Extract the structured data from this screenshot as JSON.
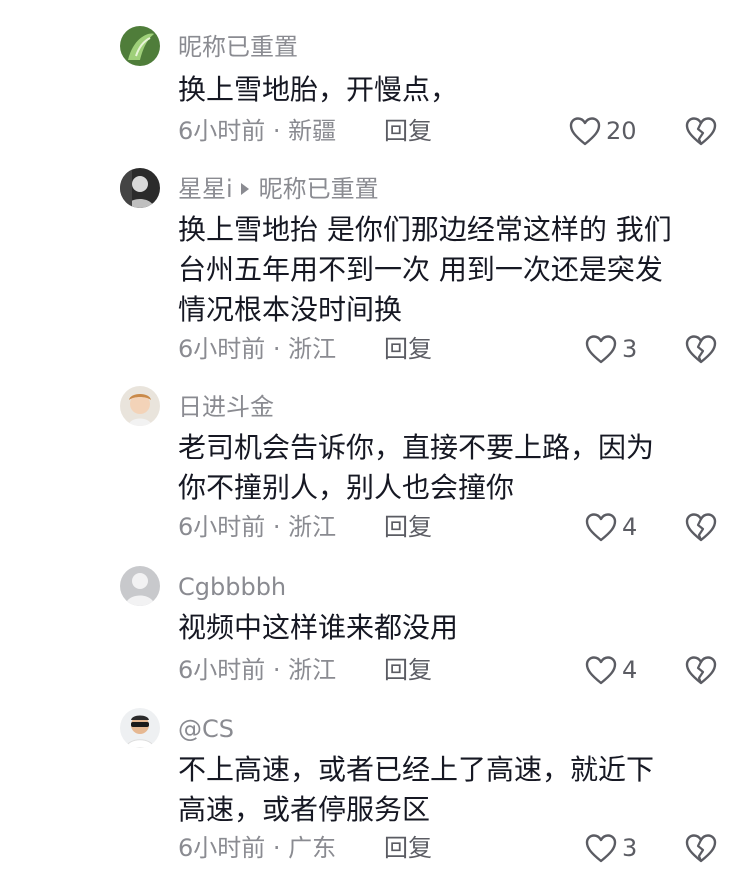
{
  "comments": [
    {
      "nickname": "昵称已重置",
      "reply_to": "",
      "lines": [
        "换上雪地胎，开慢点，"
      ],
      "time_location": "6小时前 · 新疆",
      "reply_label": "回复",
      "likes": "20",
      "avatar": "green-leaf-avatar"
    },
    {
      "nickname": "星星i",
      "reply_to": "昵称已重置",
      "lines": [
        "换上雪地抬 是你们那边经常这样的 我们",
        "台州五年用不到一次 用到一次还是突发",
        "情况根本没时间换"
      ],
      "time_location": "6小时前 · 浙江",
      "reply_label": "回复",
      "likes": "3",
      "avatar": "dark-portrait-avatar"
    },
    {
      "nickname": "日进斗金",
      "reply_to": "",
      "lines": [
        "老司机会告诉你，直接不要上路，因为",
        "你不撞别人，别人也会撞你"
      ],
      "time_location": "6小时前 · 浙江",
      "reply_label": "回复",
      "likes": "4",
      "avatar": "child-avatar"
    },
    {
      "nickname": "Cgbbbbh",
      "reply_to": "",
      "lines": [
        "视频中这样谁来都没用"
      ],
      "time_location": "6小时前 · 浙江",
      "reply_label": "回复",
      "likes": "4",
      "avatar": "default-gray-avatar"
    },
    {
      "nickname": "@CS",
      "reply_to": "",
      "lines": [
        "不上高速，或者已经上了高速，就近下",
        "高速，或者停服务区"
      ],
      "time_location": "6小时前 · 广东",
      "reply_label": "回复",
      "likes": "3",
      "avatar": "sunglasses-avatar"
    }
  ],
  "icons": {
    "like": "heart-outline-icon",
    "dislike": "broken-heart-icon"
  },
  "colors": {
    "text": "#161823",
    "meta": "#8a8b91",
    "action": "#5b5c63"
  }
}
